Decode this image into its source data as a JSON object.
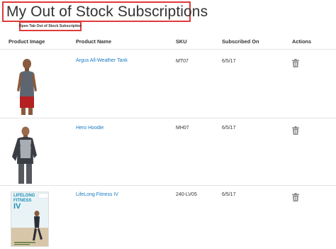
{
  "page": {
    "title": "My Out of Stock Subscriptions"
  },
  "tab_button": {
    "label": "Open Tab Out of Stock Subscription"
  },
  "table": {
    "columns": [
      "Product Image",
      "Product Name",
      "SKU",
      "Subscribed On",
      "Actions"
    ],
    "rows": [
      {
        "image_icon": "man-in-tank-top-photo",
        "name": "Argus All-Weather Tank",
        "sku": "MT07",
        "subscribed_on": "6/5/17",
        "action_icon": "trash-icon"
      },
      {
        "image_icon": "man-in-hoodie-photo",
        "name": "Hero Hoodie",
        "sku": "MH07",
        "subscribed_on": "6/5/17",
        "action_icon": "trash-icon"
      },
      {
        "image_icon": "dvd-cover-photo",
        "name": "LifeLong Fitness IV",
        "sku": "240-LV05",
        "subscribed_on": "6/5/17",
        "action_icon": "trash-icon"
      }
    ]
  },
  "dvd_cover": {
    "line1": "LIFELONG",
    "line2": "FITNESS",
    "line3": "IV"
  },
  "colors": {
    "link": "#1979c3",
    "highlight_border": "#e03a3a",
    "divider": "#e3e3e3",
    "text": "#333333"
  }
}
